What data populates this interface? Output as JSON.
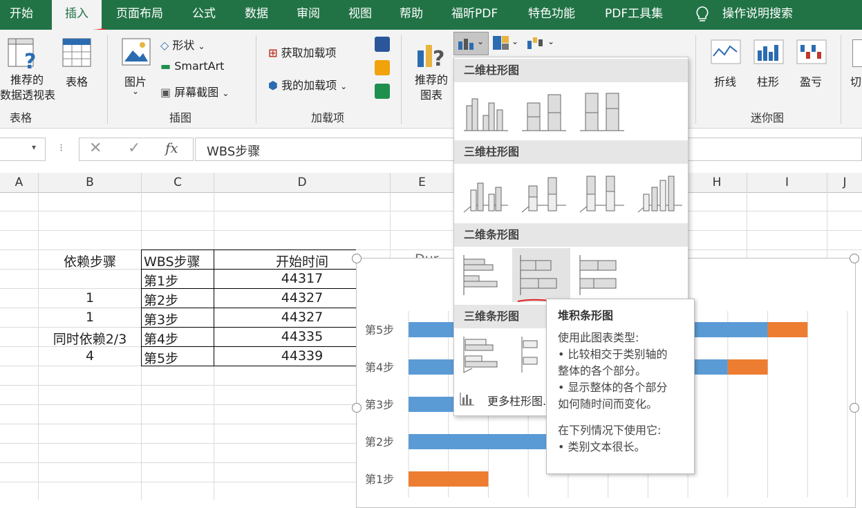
{
  "tabs": [
    "开始",
    "插入",
    "页面布局",
    "公式",
    "数据",
    "审阅",
    "视图",
    "帮助",
    "福昕PDF",
    "特色功能",
    "PDF工具集",
    "操作说明搜索"
  ],
  "ribbon": {
    "pivot": {
      "line1": "推荐的",
      "line2": "数据透视表"
    },
    "table": "表格",
    "group_tables": "表格",
    "picture": "图片",
    "shapes": "形状",
    "smartart": "SmartArt",
    "screenshot": "屏幕截图",
    "group_illustrations": "插图",
    "get_addins": "获取加载项",
    "my_addins": "我的加载项",
    "group_addins": "加载项",
    "rec_charts": {
      "line1": "推荐的",
      "line2": "图表"
    },
    "spark_line": "折线",
    "spark_column": "柱形",
    "spark_winloss": "盈亏",
    "cut_label": "切",
    "group_sparklines": "迷你图"
  },
  "formula_bar": {
    "fx": "fx",
    "value": "WBS步骤"
  },
  "columns": [
    "A",
    "B",
    "C",
    "D",
    "E",
    "H",
    "I",
    "J"
  ],
  "sheet": {
    "dep_header": "依赖步骤",
    "wbs_header": "WBS步骤",
    "start_header": "开始时间",
    "e_partial": "Dur",
    "rows": [
      {
        "dep": "",
        "wbs": "第1步",
        "start": "44317"
      },
      {
        "dep": "1",
        "wbs": "第2步",
        "start": "44327"
      },
      {
        "dep": "1",
        "wbs": "第3步",
        "start": "44327"
      },
      {
        "dep": "同时依赖2/3",
        "wbs": "第4步",
        "start": "44335"
      },
      {
        "dep": "4",
        "wbs": "第5步",
        "start": "44339"
      }
    ]
  },
  "dropdown": {
    "h1": "二维柱形图",
    "h2": "三维柱形图",
    "h3": "二维条形图",
    "h4": "三维条形图",
    "more": "更多柱形图..."
  },
  "tooltip": {
    "title": "堆积条形图",
    "l1": "使用此图表类型:",
    "l2": "• 比较相交于类别轴的",
    "l3": "整体的各个部分。",
    "l4": "• 显示整体的各个部分",
    "l5": "如何随时间而变化。",
    "l6": "在下列情况下使用它:",
    "l7": "• 类别文本很长。"
  },
  "colors": {
    "excel_green": "#217346",
    "series1": "#5b9bd5",
    "series2": "#ed7d31",
    "annotation_red": "#e02020"
  },
  "chart_data": {
    "type": "bar",
    "stacked": true,
    "orientation": "horizontal",
    "categories": [
      "第1步",
      "第2步",
      "第3步",
      "第4步",
      "第5步"
    ],
    "series": [
      {
        "values": [
          0.0,
          4.0,
          6.0,
          8.0,
          9.0
        ]
      },
      {
        "values": [
          2.0,
          1.0,
          1.0,
          1.0,
          1.0
        ]
      }
    ],
    "xlim": [
      0,
      11
    ],
    "grid": true
  }
}
